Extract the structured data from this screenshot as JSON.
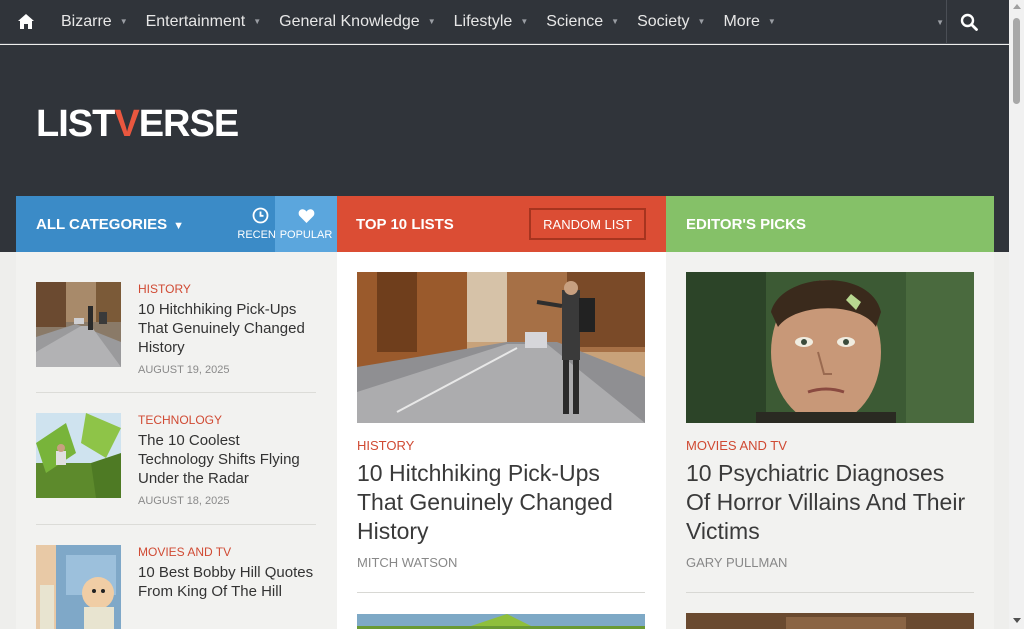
{
  "nav": {
    "items": [
      {
        "label": "Bizarre"
      },
      {
        "label": "Entertainment"
      },
      {
        "label": "General Knowledge"
      },
      {
        "label": "Lifestyle"
      },
      {
        "label": "Science"
      },
      {
        "label": "Society"
      },
      {
        "label": "More"
      }
    ],
    "caret": "▼"
  },
  "logo": {
    "part1": "LIST",
    "v": "V",
    "part2": "ERSE"
  },
  "bars": {
    "categories_label": "ALL CATEGORIES",
    "categories_caret": "▼",
    "recent_label": "RECENT",
    "popular_label": "POPULAR",
    "top10_label": "TOP 10 LISTS",
    "random_label": "RANDOM LIST",
    "editors_label": "EDITOR'S PICKS"
  },
  "recent": [
    {
      "category": "HISTORY",
      "title": "10 Hitchhiking Pick-Ups That Genuinely Changed History",
      "date": "AUGUST 19, 2025"
    },
    {
      "category": "TECHNOLOGY",
      "title": "The 10 Coolest Technology Shifts Flying Under the Radar",
      "date": "AUGUST 18, 2025"
    },
    {
      "category": "MOVIES AND TV",
      "title": "10 Best Bobby Hill Quotes From King Of The Hill",
      "date": ""
    }
  ],
  "top10": {
    "category": "HISTORY",
    "title": "10 Hitchhiking Pick-Ups That Genuinely Changed History",
    "author": "MITCH WATSON"
  },
  "editors": {
    "category": "MOVIES AND TV",
    "title": "10 Psychiatric Diagnoses Of Horror Villains And Their Victims",
    "author": "GARY PULLMAN"
  },
  "colors": {
    "nav_bg": "#30343a",
    "blue": "#3b8bc7",
    "popular": "#5ba6dd",
    "red": "#db4d34",
    "green": "#85c168",
    "accent_text": "#d04a33"
  }
}
